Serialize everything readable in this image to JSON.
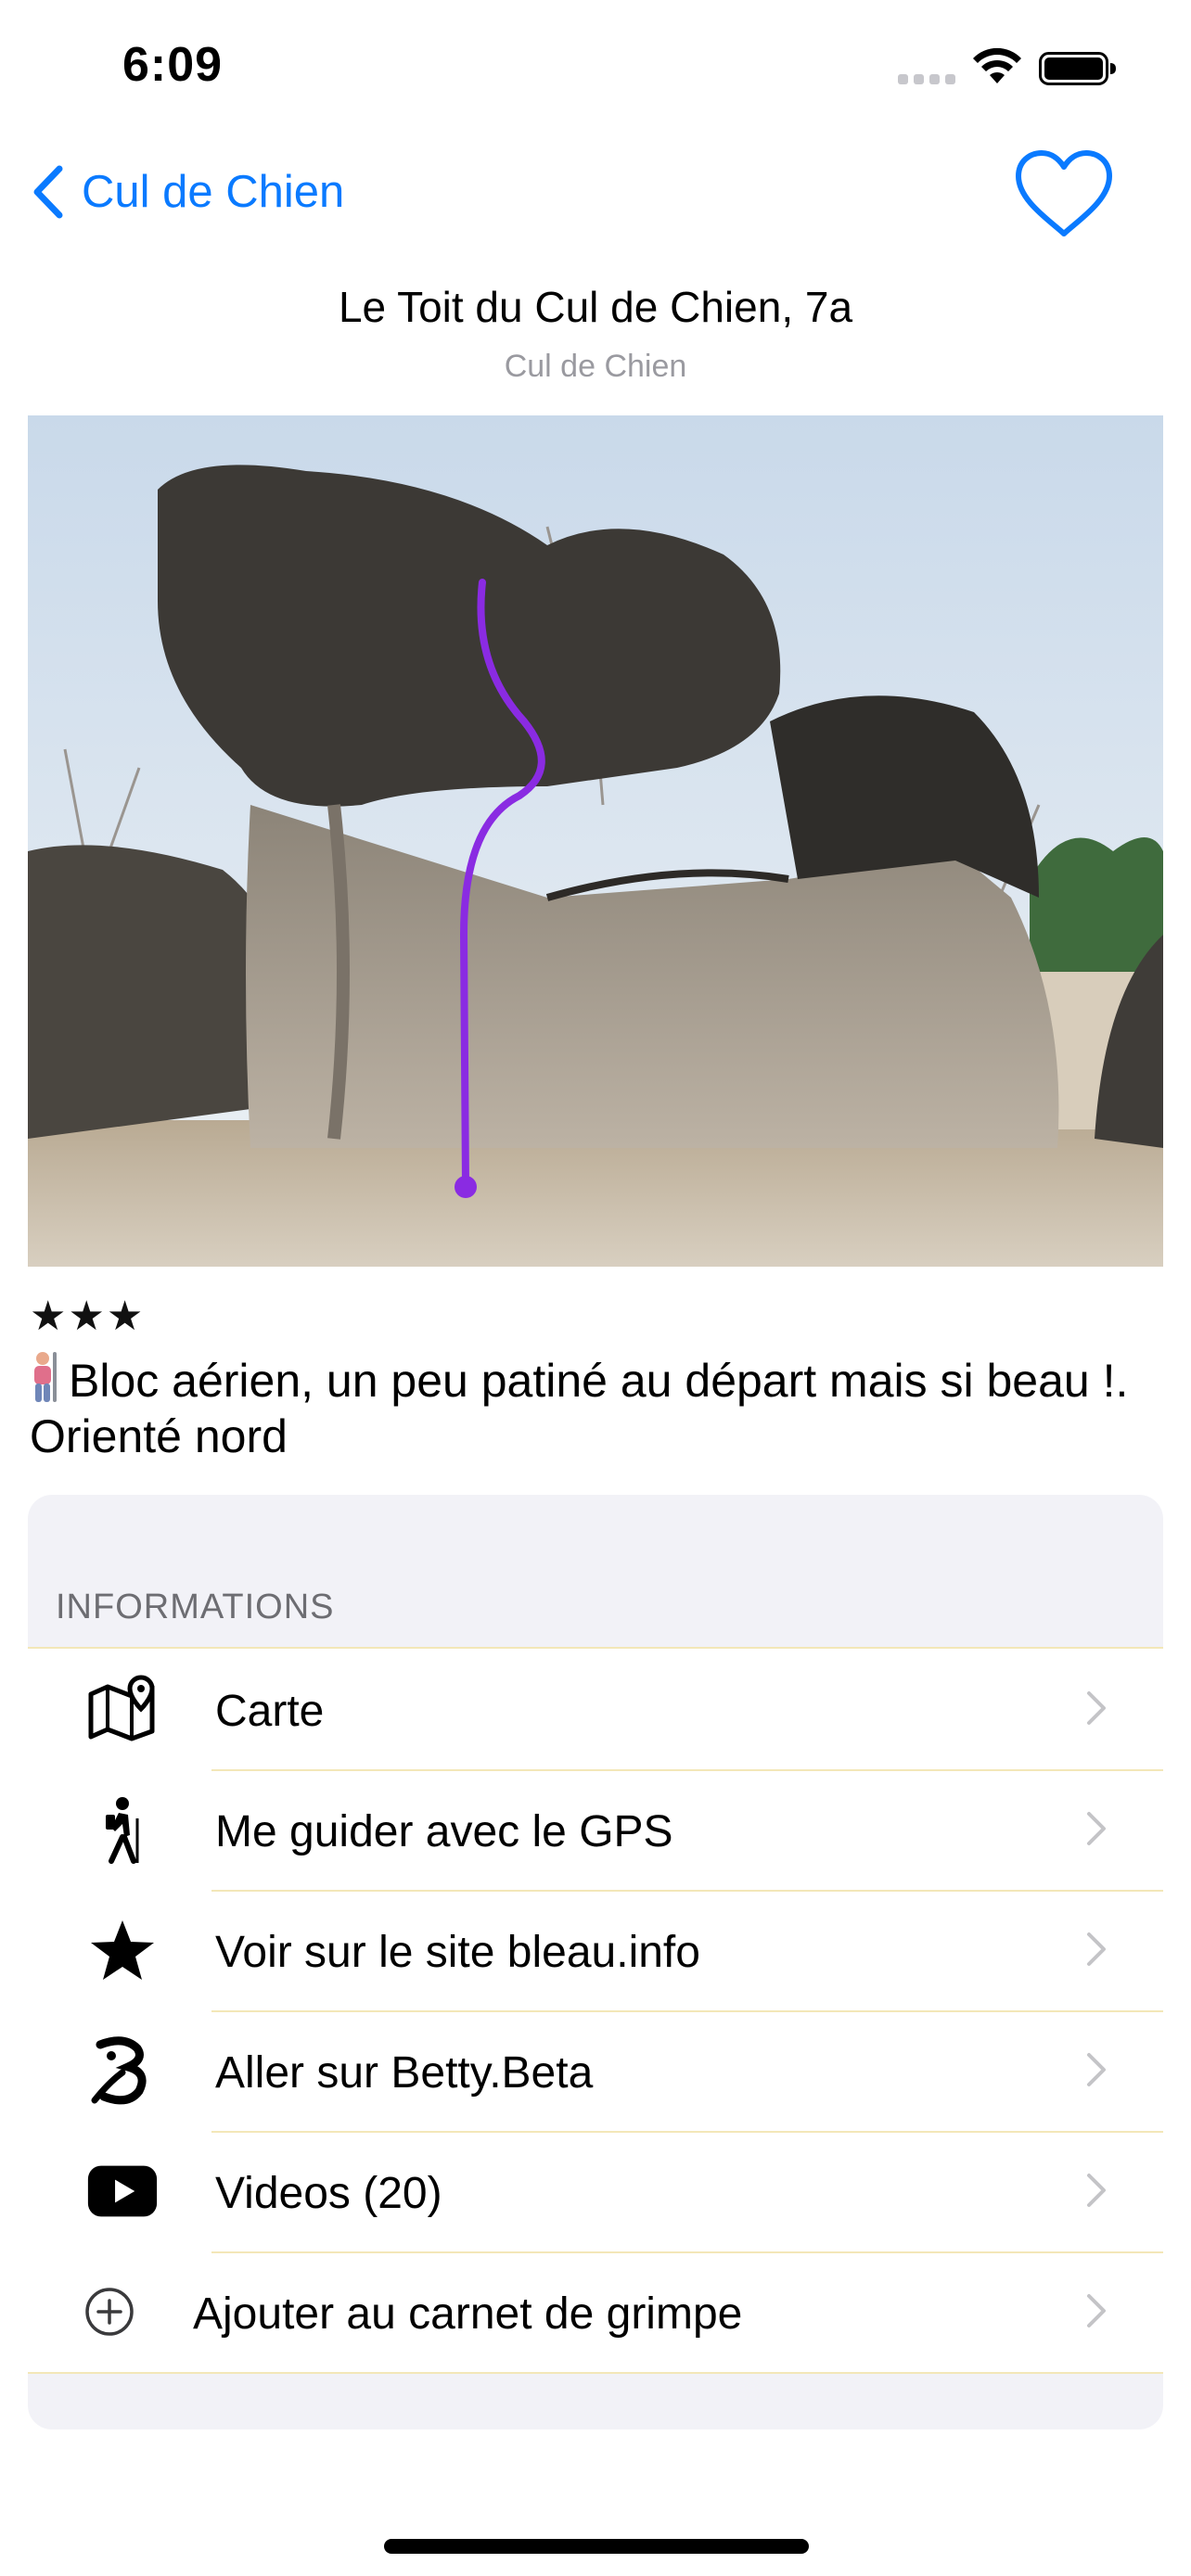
{
  "status_bar": {
    "time": "6:09"
  },
  "nav": {
    "back_label": "Cul de Chien"
  },
  "problem": {
    "title": "Le Toit du Cul de Chien, 7a",
    "area": "Cul de Chien",
    "stars": "★★★",
    "description": "Bloc aérien, un peu patiné au départ mais si beau !. Orienté nord",
    "line_color": "#8a2be2"
  },
  "informations": {
    "header": "INFORMATIONS",
    "rows": [
      {
        "label": "Carte",
        "icon": "map-icon"
      },
      {
        "label": "Me guider avec le GPS",
        "icon": "hiker-icon"
      },
      {
        "label": "Voir sur le site bleau.info",
        "icon": "star-icon"
      },
      {
        "label": "Aller sur Betty.Beta",
        "icon": "betty-beta-icon"
      },
      {
        "label": "Videos (20)",
        "icon": "youtube-icon"
      },
      {
        "label": "Ajouter au carnet de grimpe",
        "icon": "plus-circle-icon"
      }
    ]
  },
  "colors": {
    "accent": "#0a7aff",
    "separator": "#f3e7b8",
    "grouped_background": "#f2f2f7"
  }
}
